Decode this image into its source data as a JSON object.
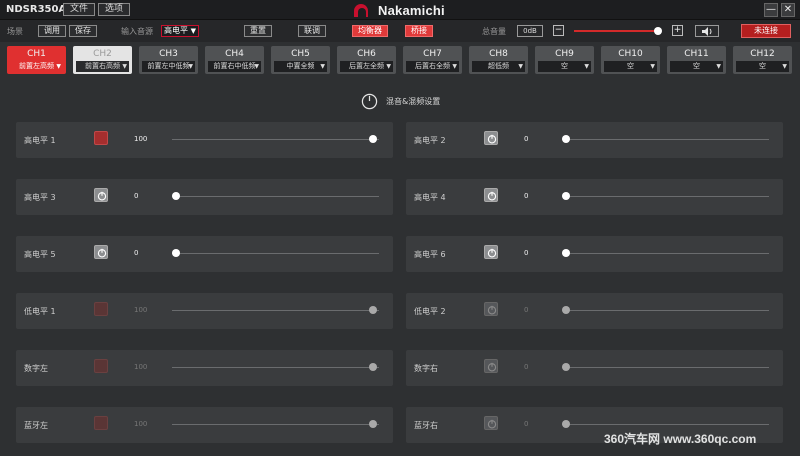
{
  "app": {
    "title": "NDSR350A",
    "brand": "Nakamichi"
  },
  "titlebar": {
    "file": "文件",
    "options": "选项",
    "minimize": "—",
    "close": "✕"
  },
  "toolbar": {
    "scene_label": "场景",
    "recall": "调用",
    "save": "保存",
    "input_source_label": "输入音源",
    "input_source_value": "高电平",
    "reset": "重置",
    "link": "联调",
    "equalizer": "均衡器",
    "crossover": "桥接",
    "master_volume_label": "总音量",
    "master_volume_value": "0dB",
    "minus": "−",
    "plus": "+",
    "master_volume_level": 1.0,
    "connection": "未连接"
  },
  "channels": [
    {
      "name": "CH1",
      "assign": "前置左高频",
      "state": "active"
    },
    {
      "name": "CH2",
      "assign": "前置右高频",
      "state": "dim"
    },
    {
      "name": "CH3",
      "assign": "前置左中低频",
      "state": "normal"
    },
    {
      "name": "CH4",
      "assign": "前置右中低频",
      "state": "normal"
    },
    {
      "name": "CH5",
      "assign": "中置全频",
      "state": "normal"
    },
    {
      "name": "CH6",
      "assign": "后置左全频",
      "state": "normal"
    },
    {
      "name": "CH7",
      "assign": "后置右全频",
      "state": "normal"
    },
    {
      "name": "CH8",
      "assign": "超低频",
      "state": "normal"
    },
    {
      "name": "CH9",
      "assign": "空",
      "state": "normal"
    },
    {
      "name": "CH10",
      "assign": "空",
      "state": "normal"
    },
    {
      "name": "CH11",
      "assign": "空",
      "state": "normal"
    },
    {
      "name": "CH12",
      "assign": "空",
      "state": "normal"
    }
  ],
  "mix": {
    "title": "混音&混频设置"
  },
  "inputs": [
    {
      "label": "高电平 1",
      "value": "100",
      "level": 1.0,
      "button": "red",
      "enabled": true
    },
    {
      "label": "高电平 2",
      "value": "0",
      "level": 0.0,
      "button": "power",
      "enabled": true
    },
    {
      "label": "高电平 3",
      "value": "0",
      "level": 0.0,
      "button": "power",
      "enabled": true
    },
    {
      "label": "高电平 4",
      "value": "0",
      "level": 0.0,
      "button": "power",
      "enabled": true
    },
    {
      "label": "高电平 5",
      "value": "0",
      "level": 0.0,
      "button": "power",
      "enabled": true
    },
    {
      "label": "高电平 6",
      "value": "0",
      "level": 0.0,
      "button": "power",
      "enabled": true
    },
    {
      "label": "低电平 1",
      "value": "100",
      "level": 1.0,
      "button": "red",
      "enabled": false
    },
    {
      "label": "低电平 2",
      "value": "0",
      "level": 0.0,
      "button": "power",
      "enabled": false
    },
    {
      "label": "数字左",
      "value": "100",
      "level": 1.0,
      "button": "red",
      "enabled": false
    },
    {
      "label": "数字右",
      "value": "0",
      "level": 0.0,
      "button": "power",
      "enabled": false
    },
    {
      "label": "蓝牙左",
      "value": "100",
      "level": 1.0,
      "button": "red",
      "enabled": false
    },
    {
      "label": "蓝牙右",
      "value": "0",
      "level": 0.0,
      "button": "power",
      "enabled": false
    }
  ],
  "watermark": "360汽车网 www.360qc.com"
}
